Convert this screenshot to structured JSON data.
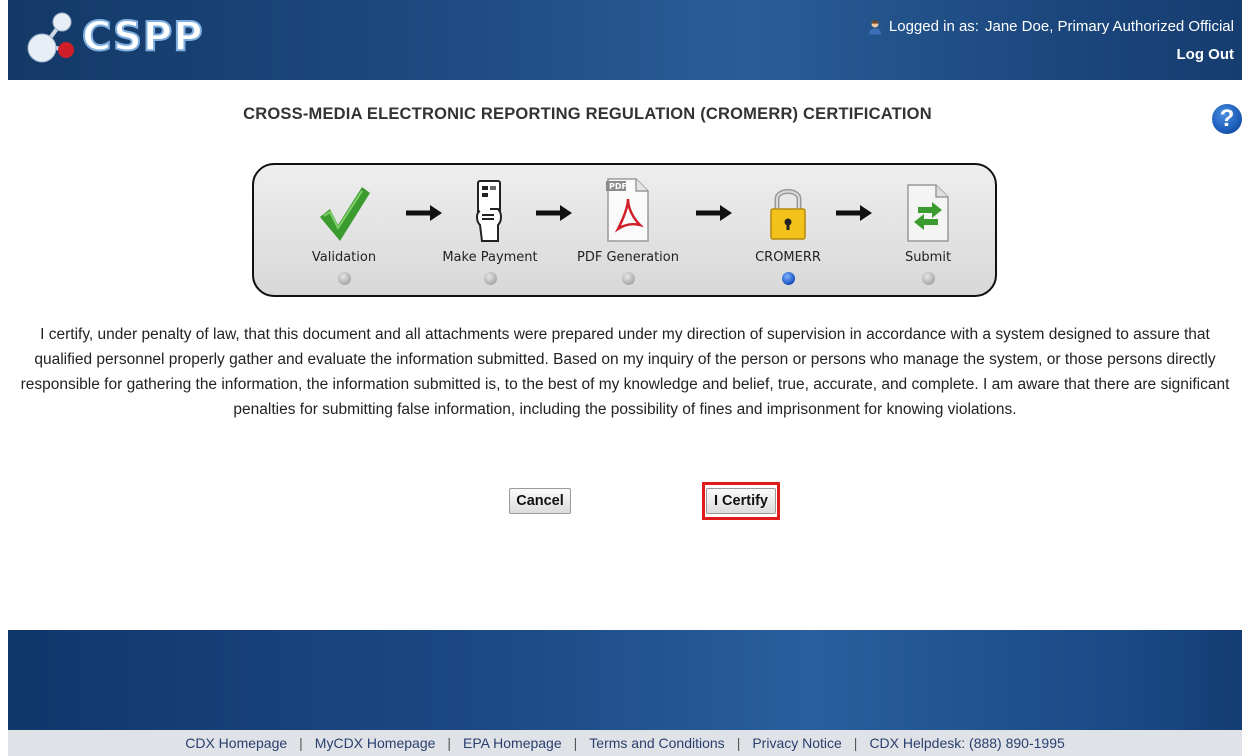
{
  "header": {
    "logo_text": "CSPP",
    "user_prefix": "Logged in as: ",
    "user_name": "Jane Doe, Primary Authorized Official",
    "logout_label": "Log Out"
  },
  "page": {
    "title": "CROSS-MEDIA ELECTRONIC REPORTING REGULATION (CROMERR) CERTIFICATION",
    "help_symbol": "?"
  },
  "steps": [
    {
      "label": "Validation",
      "icon": "checkmark-icon",
      "active": false
    },
    {
      "label": "Make Payment",
      "icon": "payment-card-icon",
      "active": false
    },
    {
      "label": "PDF Generation",
      "icon": "pdf-document-icon",
      "active": false
    },
    {
      "label": "CROMERR",
      "icon": "padlock-icon",
      "active": true
    },
    {
      "label": "Submit",
      "icon": "submit-document-icon",
      "active": false
    }
  ],
  "statement": "I certify, under penalty of law, that this document and all attachments were prepared under my direction of supervision in accordance with a system designed to assure that qualified personnel properly gather and evaluate the information submitted. Based on my inquiry of the person or persons who manage the system, or those persons directly responsible for gathering the information, the information submitted is, to the best of my knowledge and belief, true, accurate, and complete. I am aware that there are significant penalties for submitting false information, including the possibility of fines and imprisonment for knowing violations.",
  "buttons": {
    "cancel": "Cancel",
    "certify": "I Certify"
  },
  "footer": {
    "links": [
      "CDX Homepage",
      "MyCDX Homepage",
      "EPA Homepage",
      "Terms and Conditions",
      "Privacy Notice",
      "CDX Helpdesk: (888) 890-1995"
    ]
  },
  "colors": {
    "header_blue": "#1d4a80",
    "highlight_red": "#e01b1b",
    "active_step_blue": "#1c56c2"
  }
}
